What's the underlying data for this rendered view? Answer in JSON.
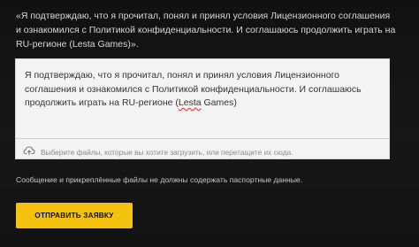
{
  "agreement_quote": "«Я подтверждаю, что я прочитал, понял и принял условия Лицензионного соглашения и ознакомился с Политикой конфиденциальности. И соглашаюсь продолжить играть на RU-регионе (Lesta Games)».",
  "message_box": {
    "text_before": "Я подтверждаю, что я прочитал, понял и принял условия Лицензионного соглашения и ознакомился с Политикой конфиденциальности. И соглашаюсь продолжить играть на RU-регионе (",
    "misspelled_word": "Lesta",
    "text_after": " Games)"
  },
  "upload": {
    "icon": "cloud-upload-icon",
    "text": "Выберите файлы, которые вы хотите загрузить, или перетащите их сюда."
  },
  "notice": "Сообщение и прикреплённые файлы не должны содержать паспортные данные.",
  "submit_label": "ОТПРАВИТЬ ЗАЯВКУ",
  "colors": {
    "background": "#141414",
    "accent": "#f5c10f",
    "form_background": "#f3f3f3"
  }
}
